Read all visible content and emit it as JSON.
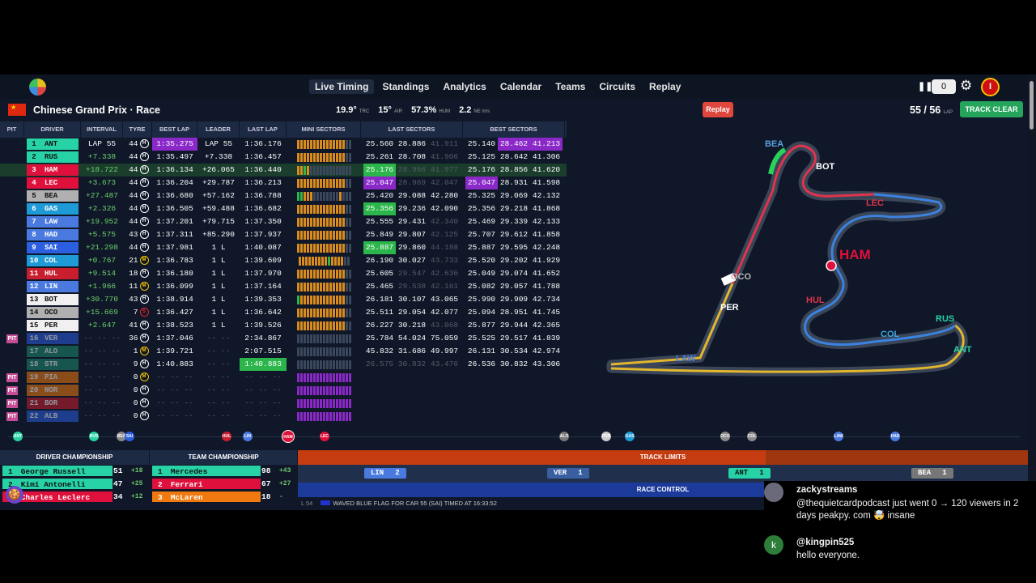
{
  "nav": {
    "links": [
      "Live Timing",
      "Standings",
      "Analytics",
      "Calendar",
      "Teams",
      "Circuits",
      "Replay"
    ],
    "active": "Live Timing",
    "counter": "0",
    "avatar_letter": "I"
  },
  "session": {
    "flag_emoji": "CN",
    "title": "Chinese Grand Prix · Race",
    "track_temp": "19.9°",
    "track_temp_unit": "TRC",
    "air_temp": "15°",
    "air_unit": "AIR",
    "humidity": "57.3%",
    "hum_unit": "HUM",
    "wind": "2.2",
    "wind_unit": "NE m/s",
    "replay_label": "Replay",
    "lap_current": "55",
    "lap_total": "56",
    "lap_unit": "LAP",
    "track_status": "TRACK CLEAR"
  },
  "table": {
    "headers": [
      "PIT",
      "DRIVER",
      "INTERVAL",
      "TYRE",
      "BEST LAP",
      "LEADER",
      "LAST LAP",
      "MINI SECTORS",
      "LAST SECTORS",
      "BEST SECTORS"
    ],
    "rows": [
      {
        "pit": "",
        "pos": "1",
        "code": "ANT",
        "color": "#27d3a6",
        "interval": "LAP 55",
        "tyre": "H",
        "tlaps": "44",
        "best": "1:35.275",
        "bestc": "purple",
        "leader": "LAP 55",
        "last": "1:36.176",
        "ls": [
          "25.560",
          "28.886",
          "41.911"
        ],
        "lsd": [
          0,
          0,
          1
        ],
        "bs": [
          "25.140",
          "28.462",
          "41.213"
        ],
        "bsc": [
          "",
          "purple",
          "purple"
        ],
        "mini": "yyyyyyyyyyyyyyydd"
      },
      {
        "pit": "",
        "pos": "2",
        "code": "RUS",
        "color": "#27d3a6",
        "interval": "+7.338",
        "tyre": "H",
        "tlaps": "44",
        "best": "1:35.497",
        "leader": "+7.338",
        "last": "1:36.457",
        "ls": [
          "25.261",
          "28.708",
          "41.906"
        ],
        "lsd": [
          0,
          0,
          1
        ],
        "bs": [
          "25.125",
          "28.642",
          "41.306"
        ],
        "mini": "yyyyyyyyyyyyyyydd"
      },
      {
        "pit": "",
        "pos": "3",
        "code": "HAM",
        "color": "#e0103c",
        "interval": "+18.722",
        "tyre": "H",
        "tlaps": "44",
        "best": "1:36.134",
        "leader": "+26.065",
        "last": "1:36.440",
        "ls": [
          "25.176",
          "28.966",
          "41.977"
        ],
        "lsc": [
          "green",
          "",
          ""
        ],
        "lsd": [
          0,
          1,
          1
        ],
        "bs": [
          "25.176",
          "28.856",
          "41.620"
        ],
        "mini": "yygyddddddddddddd",
        "hl": true
      },
      {
        "pit": "",
        "pos": "4",
        "code": "LEC",
        "color": "#e0103c",
        "interval": "+3.673",
        "tyre": "H",
        "tlaps": "44",
        "best": "1:36.204",
        "leader": "+29.787",
        "last": "1:36.213",
        "ls": [
          "25.047",
          "28.969",
          "42.047"
        ],
        "lsc": [
          "purple",
          "",
          ""
        ],
        "lsd": [
          0,
          1,
          1
        ],
        "bs": [
          "25.047",
          "28.931",
          "41.598"
        ],
        "bsc": [
          "purple",
          "",
          ""
        ],
        "mini": "yyyyyyyyyyyyyyydd"
      },
      {
        "pit": "",
        "pos": "5",
        "code": "BEA",
        "color": "#b0b0b0",
        "interval": "+27.487",
        "tyre": "H",
        "tlaps": "44",
        "best": "1:36.680",
        "leader": "+57.162",
        "last": "1:36.788",
        "ls": [
          "25.420",
          "29.088",
          "42.280"
        ],
        "bs": [
          "25.325",
          "29.069",
          "42.132"
        ],
        "mini": "ggyyyddddddddyddd"
      },
      {
        "pit": "",
        "pos": "6",
        "code": "GAS",
        "color": "#1e9ad6",
        "interval": "+2.326",
        "tyre": "H",
        "tlaps": "44",
        "best": "1:36.505",
        "leader": "+59.488",
        "last": "1:36.682",
        "ls": [
          "25.356",
          "29.236",
          "42.090"
        ],
        "lsc": [
          "green",
          "",
          ""
        ],
        "bs": [
          "25.356",
          "29.218",
          "41.868"
        ],
        "mini": "yyyyyyyyyyyyyyydd"
      },
      {
        "pit": "",
        "pos": "7",
        "code": "LAW",
        "color": "#4a7ae0",
        "interval": "+19.952",
        "tyre": "H",
        "tlaps": "44",
        "best": "1:37.201",
        "leader": "+79.715",
        "last": "1:37.350",
        "ls": [
          "25.555",
          "29.431",
          "42.340"
        ],
        "lsd": [
          0,
          0,
          1
        ],
        "bs": [
          "25.469",
          "29.339",
          "42.133"
        ],
        "mini": "yyyyyyyyyyyyyyydd"
      },
      {
        "pit": "",
        "pos": "8",
        "code": "HAD",
        "color": "#4a7ae0",
        "interval": "+5.575",
        "tyre": "H",
        "tlaps": "43",
        "best": "1:37.311",
        "leader": "+85.290",
        "last": "1:37.937",
        "ls": [
          "25.849",
          "29.807",
          "42.125"
        ],
        "lsd": [
          0,
          0,
          1
        ],
        "bs": [
          "25.707",
          "29.612",
          "41.858"
        ],
        "mini": "yyyyyyyyyyyyyyydd"
      },
      {
        "pit": "",
        "pos": "9",
        "code": "SAI",
        "color": "#2b5fe0",
        "interval": "+21.298",
        "tyre": "H",
        "tlaps": "44",
        "best": "1:37.981",
        "leader": "1 L",
        "last": "1:40.087",
        "ls": [
          "25.887",
          "29.860",
          "44.188"
        ],
        "lsc": [
          "green",
          "",
          ""
        ],
        "lsd": [
          0,
          0,
          1
        ],
        "bs": [
          "25.887",
          "29.595",
          "42.248"
        ],
        "mini": "yyyyyyyyyyyyyyydd"
      },
      {
        "pit": "",
        "pos": "10",
        "code": "COL",
        "color": "#1e9ad6",
        "interval": "+0.767",
        "tyre": "M",
        "tlaps": "21",
        "best": "1:36.783",
        "leader": "1 L",
        "last": "1:39.609",
        "ls": [
          "26.190",
          "30.027",
          "43.733"
        ],
        "lsd": [
          0,
          0,
          1
        ],
        "bs": [
          "25.520",
          "29.202",
          "41.929"
        ],
        "mini": "yyyyyyyyygyyyydd"
      },
      {
        "pit": "",
        "pos": "11",
        "code": "HUL",
        "color": "#c81e2e",
        "interval": "+9.514",
        "tyre": "H",
        "tlaps": "18",
        "best": "1:36.180",
        "leader": "1 L",
        "last": "1:37.970",
        "ls": [
          "25.605",
          "29.547",
          "42.636"
        ],
        "lsd": [
          0,
          1,
          1
        ],
        "bs": [
          "25.049",
          "29.074",
          "41.652"
        ],
        "mini": "yyyyyyyyyyyyyyydd"
      },
      {
        "pit": "",
        "pos": "12",
        "code": "LIN",
        "color": "#4a7ae0",
        "interval": "+1.966",
        "tyre": "M",
        "tlaps": "11",
        "best": "1:36.099",
        "leader": "1 L",
        "last": "1:37.164",
        "ls": [
          "25.465",
          "29.538",
          "42.161"
        ],
        "lsd": [
          0,
          1,
          1
        ],
        "bs": [
          "25.082",
          "29.057",
          "41.788"
        ],
        "mini": "yyyyyyyyyyyyyyydd"
      },
      {
        "pit": "",
        "pos": "13",
        "code": "BOT",
        "color": "#f0f0f0",
        "interval": "+30.770",
        "tyre": "H",
        "tlaps": "43",
        "best": "1:38.914",
        "leader": "1 L",
        "last": "1:39.353",
        "ls": [
          "26.181",
          "30.107",
          "43.065"
        ],
        "bs": [
          "25.990",
          "29.909",
          "42.734"
        ],
        "mini": "gyyyyyyyyyyyyyydd"
      },
      {
        "pit": "",
        "pos": "14",
        "code": "OCO",
        "color": "#b0b0b0",
        "interval": "+15.669",
        "tyre": "S",
        "tlaps": "7",
        "best": "1:36.427",
        "leader": "1 L",
        "last": "1:36.642",
        "ls": [
          "25.511",
          "29.054",
          "42.077"
        ],
        "bs": [
          "25.094",
          "28.951",
          "41.745"
        ],
        "mini": "yyyyyyyyyyyyyyydd"
      },
      {
        "pit": "",
        "pos": "15",
        "code": "PER",
        "color": "#f0f0f0",
        "interval": "+2.647",
        "tyre": "H",
        "tlaps": "41",
        "best": "1:38.523",
        "leader": "1 L",
        "last": "1:39.526",
        "ls": [
          "26.227",
          "30.218",
          "43.068"
        ],
        "lsd": [
          0,
          0,
          1
        ],
        "bs": [
          "25.877",
          "29.944",
          "42.365"
        ],
        "mini": "yyyyyyyyyyyyyyydd"
      },
      {
        "pit": "PIT",
        "pos": "16",
        "code": "VER",
        "color": "#2b5fe0",
        "interval": "-- -- --",
        "tyre": "H",
        "tlaps": "36",
        "best": "1:37.046",
        "leader": "-- --",
        "last": "2:34.867",
        "ls": [
          "25.784",
          "54.024",
          "75.059"
        ],
        "bs": [
          "25.525",
          "29.517",
          "41.839"
        ],
        "mini": "ddddddddddddddddd",
        "out": true
      },
      {
        "pit": "",
        "pos": "17",
        "code": "ALO",
        "color": "#1e8a6e",
        "interval": "-- -- --",
        "tyre": "M",
        "tlaps": "1",
        "best": "1:39.721",
        "leader": "-- --",
        "last": "2:07.515",
        "ls": [
          "45.832",
          "31.686",
          "49.997"
        ],
        "bs": [
          "26.131",
          "30.534",
          "42.974"
        ],
        "mini": "ddddddddddddddddd",
        "out": true
      },
      {
        "pit": "",
        "pos": "18",
        "code": "STR",
        "color": "#1e8a6e",
        "interval": "-- -- --",
        "tyre": "H",
        "tlaps": "9",
        "best": "1:40.883",
        "leader": "-- --",
        "last": "1:40.883",
        "lastc": "green",
        "ls": [
          "26.575",
          "30.832",
          "43.476"
        ],
        "lsd": [
          1,
          1,
          1
        ],
        "bs": [
          "26.536",
          "30.832",
          "43.306"
        ],
        "mini": "ddddddddddddddddd",
        "out": true
      },
      {
        "pit": "PIT",
        "pos": "19",
        "code": "PIA",
        "color": "#f07a10",
        "interval": "-- -- --",
        "tyre": "M",
        "tlaps": "0",
        "best": "-- -- --",
        "leader": "-- --",
        "last": "-- -- --",
        "ls": [
          "",
          "",
          ""
        ],
        "bs": [
          "",
          "",
          ""
        ],
        "mini": "ppppppppppppppppp",
        "out": true
      },
      {
        "pit": "PIT",
        "pos": "20",
        "code": "NOR",
        "color": "#f07a10",
        "interval": "-- -- --",
        "tyre": "H",
        "tlaps": "0",
        "best": "-- -- --",
        "leader": "-- --",
        "last": "-- -- --",
        "ls": [
          "",
          "",
          ""
        ],
        "bs": [
          "",
          "",
          ""
        ],
        "mini": "ppppppppppppppppp",
        "out": true
      },
      {
        "pit": "PIT",
        "pos": "21",
        "code": "BOR",
        "color": "#c81e2e",
        "interval": "-- -- --",
        "tyre": "H",
        "tlaps": "0",
        "best": "-- -- --",
        "leader": "-- --",
        "last": "-- -- --",
        "ls": [
          "",
          "",
          ""
        ],
        "bs": [
          "",
          "",
          ""
        ],
        "mini": "ppppppppppppppppp",
        "out": true
      },
      {
        "pit": "PIT",
        "pos": "22",
        "code": "ALB",
        "color": "#2b5fe0",
        "interval": "-- -- --",
        "tyre": "H",
        "tlaps": "0",
        "best": "-- -- --",
        "leader": "-- --",
        "last": "-- -- --",
        "ls": [
          "",
          "",
          ""
        ],
        "bs": [
          "",
          "",
          ""
        ],
        "mini": "ppppppppppppppppp",
        "out": true
      }
    ]
  },
  "map": {
    "labels": [
      "BEA",
      "BOT",
      "LEC",
      "HAM",
      "OCO",
      "HUL",
      "PER",
      "RUS",
      "COL",
      "ANT",
      "LAW"
    ],
    "highlight": "HAM"
  },
  "timeline": [
    "ANT",
    "RUS",
    "BEA",
    "HAM",
    "LIN",
    "HUL",
    "LEC",
    "GAS",
    "OCO",
    "COL",
    "LAW",
    "HAD",
    "SAI",
    "PER",
    "ALO"
  ],
  "driver_champ": {
    "title": "DRIVER CHAMPIONSHIP",
    "rows": [
      {
        "pos": "1",
        "name": "George Russell",
        "pts": "51",
        "gain": "+18",
        "color": "#27d3a6"
      },
      {
        "pos": "2",
        "name": "Kimi Antonelli",
        "pts": "47",
        "gain": "+25",
        "color": "#27d3a6"
      },
      {
        "pos": "3",
        "name": "Charles Leclerc",
        "pts": "34",
        "gain": "+12",
        "color": "#e0103c"
      }
    ]
  },
  "team_champ": {
    "title": "TEAM CHAMPIONSHIP",
    "rows": [
      {
        "pos": "1",
        "name": "Mercedes",
        "pts": "98",
        "gain": "+43",
        "color": "#27d3a6"
      },
      {
        "pos": "2",
        "name": "Ferrari",
        "pts": "67",
        "gain": "+27",
        "color": "#e0103c"
      },
      {
        "pos": "3",
        "name": "McLaren",
        "pts": "18",
        "gain": "-",
        "color": "#f07a10"
      }
    ]
  },
  "track_limits": {
    "title": "TRACK LIMITS",
    "items": [
      {
        "code": "LIN",
        "count": "2",
        "color": "#4a7ae0"
      },
      {
        "code": "VER",
        "count": "1",
        "color": "#3a5fa0"
      },
      {
        "code": "ANT",
        "count": "1",
        "color": "#27d3a6"
      },
      {
        "code": "BEA",
        "count": "1",
        "color": "#777"
      }
    ]
  },
  "race_control": {
    "title": "RACE CONTROL",
    "lap": "L 54",
    "message": "WAVED BLUE FLAG FOR CAR 55 (SAI) TIMED AT 16:33:52"
  },
  "chat": [
    {
      "name": "zackystreams",
      "text": ""
    },
    {
      "name": "",
      "text": "@thequietcardpodcast just went 0 → 120 viewers in 2 days peakpy. com 🤯 insane"
    },
    {
      "name": "@kingpin525",
      "text": "hello everyone."
    }
  ],
  "colors": {
    "accent": "#8a28c8",
    "green": "#2bb54a",
    "track_clear": "#25a55c",
    "replay": "#e0463c"
  }
}
